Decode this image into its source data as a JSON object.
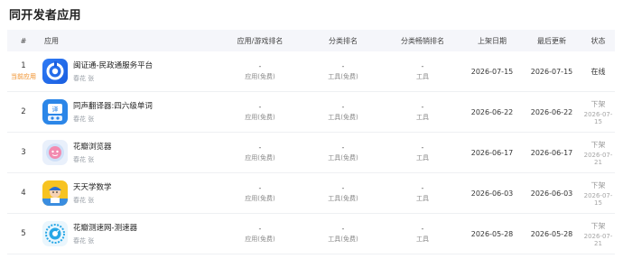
{
  "page": {
    "title": "同开发者应用"
  },
  "header": {
    "index": "#",
    "app": "应用",
    "rank": "应用/游戏排名",
    "category_rank": "分类排名",
    "category_paid_rank": "分类畅销排名",
    "release_date": "上架日期",
    "last_update": "最后更新",
    "status": "状态"
  },
  "rows": [
    {
      "index": "1",
      "tag": "当前应用",
      "name": "闽证通-民政通服务平台",
      "developer": "春花 张",
      "rank": "-",
      "rank_sub": "应用(免费)",
      "cat": "-",
      "cat_sub": "工具(免费)",
      "pay": "-",
      "pay_sub": "工具",
      "release": "2026-07-15",
      "update": "2026-07-15",
      "status": "在线",
      "status_date": ""
    },
    {
      "index": "2",
      "tag": "",
      "name": "同声翻译器:四六级单词",
      "developer": "春花 张",
      "rank": "-",
      "rank_sub": "应用(免费)",
      "cat": "-",
      "cat_sub": "工具(免费)",
      "pay": "-",
      "pay_sub": "工具",
      "release": "2026-06-22",
      "update": "2026-06-22",
      "status": "下架",
      "status_date": "2026-07-15"
    },
    {
      "index": "3",
      "tag": "",
      "name": "花瓣浏览器",
      "developer": "春花 张",
      "rank": "-",
      "rank_sub": "应用(免费)",
      "cat": "-",
      "cat_sub": "工具(免费)",
      "pay": "-",
      "pay_sub": "工具",
      "release": "2026-06-17",
      "update": "2026-06-17",
      "status": "下架",
      "status_date": "2026-07-21"
    },
    {
      "index": "4",
      "tag": "",
      "name": "天天学数学",
      "developer": "春花 张",
      "rank": "-",
      "rank_sub": "应用(免费)",
      "cat": "-",
      "cat_sub": "工具(免费)",
      "pay": "-",
      "pay_sub": "工具",
      "release": "2026-06-03",
      "update": "2026-06-03",
      "status": "下架",
      "status_date": "2026-07-15"
    },
    {
      "index": "5",
      "tag": "",
      "name": "花瓣测速网-测速器",
      "developer": "春花 张",
      "rank": "-",
      "rank_sub": "应用(免费)",
      "cat": "-",
      "cat_sub": "工具(免费)",
      "pay": "-",
      "pay_sub": "工具",
      "release": "2026-05-28",
      "update": "2026-05-28",
      "status": "下架",
      "status_date": "2026-07-21"
    }
  ],
  "colors": {
    "tag": "#ef8a1f",
    "header_bg": "#f5f6fa",
    "offline": "#999999"
  },
  "icons": [
    "app-icon-minzhengtong",
    "app-icon-translator",
    "app-icon-browser",
    "app-icon-math",
    "app-icon-speedtest"
  ]
}
